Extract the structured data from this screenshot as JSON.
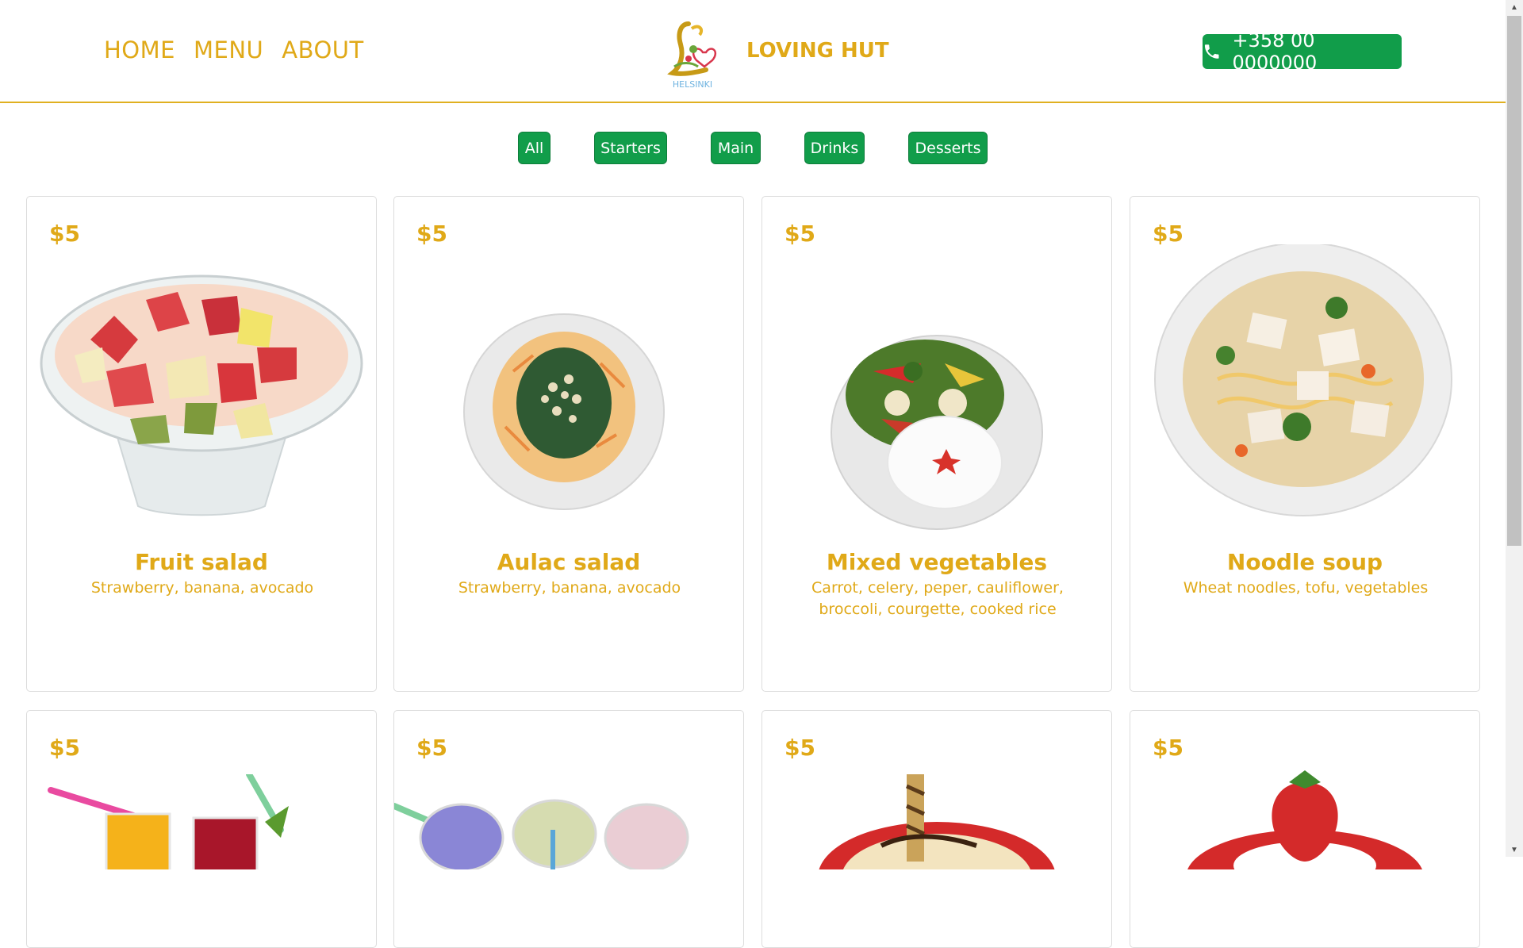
{
  "nav": {
    "items": [
      "HOME",
      "MENU",
      "ABOUT"
    ]
  },
  "brand": {
    "name": "LOVING HUT",
    "logo_text": "HELSINKI"
  },
  "phone": {
    "number": "+358 00 0000000",
    "icon": "phone-icon"
  },
  "filters": [
    "All",
    "Starters",
    "Main",
    "Drinks",
    "Desserts"
  ],
  "menu": [
    {
      "price": "$5",
      "name": "Fruit salad",
      "desc": "Strawberry, banana, avocado"
    },
    {
      "price": "$5",
      "name": "Aulac salad",
      "desc": "Strawberry, banana, avocado"
    },
    {
      "price": "$5",
      "name": "Mixed vegetables",
      "desc": "Carrot, celery, peper, cauliflower, broccoli, courgette, cooked rice"
    },
    {
      "price": "$5",
      "name": "Noodle soup",
      "desc": "Wheat noodles, tofu, vegetables"
    },
    {
      "price": "$5"
    },
    {
      "price": "$5"
    },
    {
      "price": "$5"
    },
    {
      "price": "$5"
    }
  ],
  "colors": {
    "accent": "#e0a918",
    "button_green": "#119d4a",
    "card_border": "#dcdcdc"
  }
}
